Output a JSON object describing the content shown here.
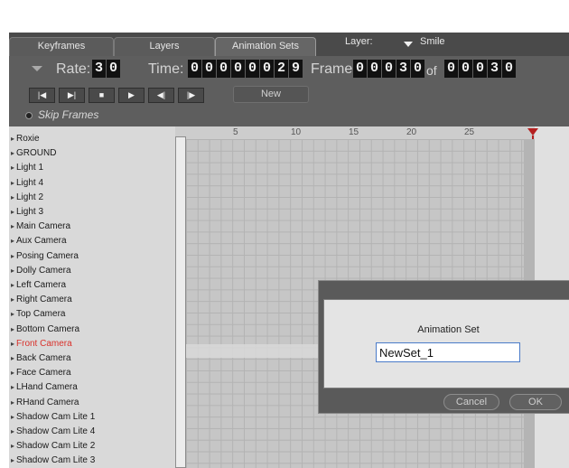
{
  "tabs": [
    {
      "label": "Keyframes"
    },
    {
      "label": "Layers"
    },
    {
      "label": "Animation Sets"
    }
  ],
  "layer": {
    "label": "Layer:",
    "value": "Smile"
  },
  "controls": {
    "rate_label": "Rate:",
    "rate_digits": [
      "3",
      "0"
    ],
    "time_label": "Time:",
    "time_digits": [
      "0",
      "0",
      "0",
      "0",
      "0",
      "0",
      "2",
      "9"
    ],
    "frame_label": "Frame:",
    "frame_digits": [
      "0",
      "0",
      "0",
      "3",
      "0"
    ],
    "of_label": "of",
    "total_digits": [
      "0",
      "0",
      "0",
      "3",
      "0"
    ]
  },
  "transport": [
    {
      "name": "go-to-start-icon",
      "glyph": "|◀"
    },
    {
      "name": "go-to-end-icon",
      "glyph": "▶|"
    },
    {
      "name": "stop-icon",
      "glyph": "■"
    },
    {
      "name": "play-icon",
      "glyph": "▶"
    },
    {
      "name": "step-back-icon",
      "glyph": "◀|"
    },
    {
      "name": "step-forward-icon",
      "glyph": "|▶"
    }
  ],
  "new_button": "New",
  "skip_frames": "Skip Frames",
  "list": {
    "selected": "Front Camera",
    "items": [
      "Roxie",
      "GROUND",
      "Light 1",
      "Light 4",
      "Light 2",
      "Light 3",
      "Main Camera",
      "Aux Camera",
      "Posing Camera",
      "Dolly Camera",
      "Left Camera",
      "Right Camera",
      "Top Camera",
      "Bottom Camera",
      "Front Camera",
      "Back Camera",
      "Face Camera",
      "LHand Camera",
      "RHand Camera",
      "Shadow Cam Lite 1",
      "Shadow Cam Lite 4",
      "Shadow Cam Lite 2",
      "Shadow Cam Lite 3"
    ]
  },
  "timeline": {
    "ticks": [
      "5",
      "10",
      "15",
      "20",
      "25"
    ],
    "current_frame": 30
  },
  "dialog": {
    "title": "Animation Set",
    "input_value": "NewSet_1",
    "cancel_label": "Cancel",
    "ok_label": "OK"
  },
  "colors": {
    "selected_item": "#d9312b",
    "current_frame_marker": "#b52020"
  }
}
